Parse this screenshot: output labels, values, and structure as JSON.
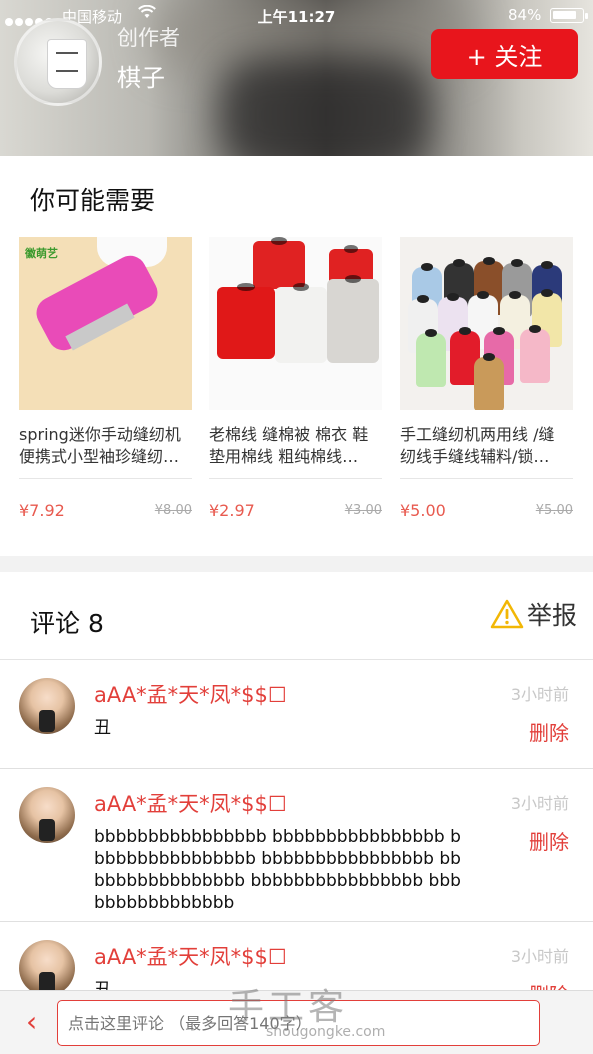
{
  "status_bar": {
    "carrier": "中国移动",
    "time": "上午11:27",
    "battery_percent": "84%",
    "battery_level": 0.84
  },
  "header": {
    "creator_label": "创作者",
    "creator_name": "棋子",
    "follow_label": "+ 关注",
    "accent_color": "#e8151c"
  },
  "recommendations": {
    "title": "你可能需要",
    "items": [
      {
        "name": "spring迷你手动缝纫机 便携式小型袖珍缝纫…",
        "price": "¥7.92",
        "original_price": "¥8.00",
        "thumb_brand": "徽萌艺"
      },
      {
        "name": "老棉线 缝棉被 棉衣 鞋 垫用棉线 粗纯棉线…",
        "price": "¥2.97",
        "original_price": "¥3.00"
      },
      {
        "name": "手工缝纫机两用线 /缝 纫线手缝线辅料/锁…",
        "price": "¥5.00",
        "original_price": "¥5.00"
      }
    ]
  },
  "comments": {
    "title": "评论",
    "count": "8",
    "report_label": "举报",
    "items": [
      {
        "user": "aAA*孟*天*凤*$$☐",
        "time": "3小时前",
        "text": "丑",
        "delete_label": "删除"
      },
      {
        "user": "aAA*孟*天*凤*$$☐",
        "time": "3小时前",
        "text": "bbbbbbbbbbbbbbbb bbbbbbbbbbbbbbbb bbbbbbbbbbbbbbbb bbbbbbbbbbbbbbbb bbbbbbbbbbbbbbbb bbbbbbbbbbbbbbbb bbbbbbbbbbbbbbbb",
        "delete_label": "删除"
      },
      {
        "user": "aAA*孟*天*凤*$$☐",
        "time": "3小时前",
        "text": "丑",
        "delete_label": "删除"
      }
    ]
  },
  "bottom_bar": {
    "input_placeholder": "点击这里评论 （最多回答140字）"
  },
  "watermark": {
    "text": "手工客",
    "url": "shougongke.com"
  }
}
